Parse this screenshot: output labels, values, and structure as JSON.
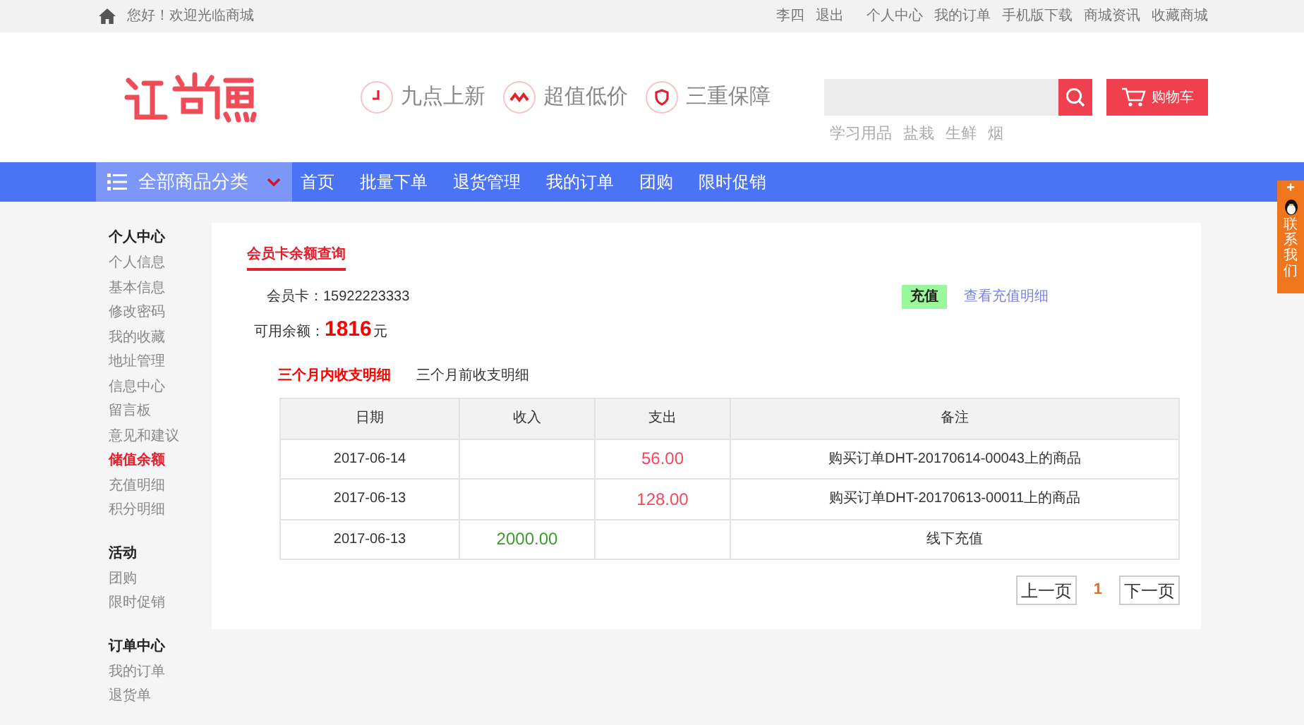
{
  "top_bar": {
    "greeting": "您好！欢迎光临商城",
    "links": [
      "李四",
      "退出",
      "个人中心",
      "我的订单",
      "手机版下载",
      "商城资讯",
      "收藏商城"
    ]
  },
  "header": {
    "promises": [
      "九点上新",
      "超值低价",
      "三重保障"
    ],
    "search": {
      "hot_words": [
        "学习用品",
        "盐栽",
        "生鲜",
        "烟"
      ]
    },
    "cart_button": "购物车"
  },
  "nav": {
    "category": "全部商品分类",
    "items": [
      "首页",
      "批量下单",
      "退货管理",
      "我的订单",
      "团购",
      "限时促销"
    ]
  },
  "sidebar": [
    {
      "title": "个人中心",
      "items": [
        {
          "label": "个人信息",
          "selected": false
        },
        {
          "label": "基本信息",
          "selected": false
        },
        {
          "label": "修改密码",
          "selected": false
        },
        {
          "label": "我的收藏",
          "selected": false
        },
        {
          "label": "地址管理",
          "selected": false
        },
        {
          "label": "信息中心",
          "selected": false
        },
        {
          "label": "留言板",
          "selected": false
        },
        {
          "label": "意见和建议",
          "selected": false
        },
        {
          "label": "储值余额",
          "selected": true
        },
        {
          "label": "充值明细",
          "selected": false
        },
        {
          "label": "积分明细",
          "selected": false
        }
      ]
    },
    {
      "title": "活动",
      "items": [
        {
          "label": "团购",
          "selected": false
        },
        {
          "label": "限时促销",
          "selected": false
        }
      ]
    },
    {
      "title": "订单中心",
      "items": [
        {
          "label": "我的订单",
          "selected": false
        },
        {
          "label": "退货单",
          "selected": false
        }
      ]
    }
  ],
  "content": {
    "title": "会员卡余额查询",
    "card_label": "会员卡：",
    "card_number": "15922223333",
    "recharge_button": "充值",
    "recharge_detail_link": "查看充值明细",
    "balance_label": "可用余额：",
    "balance": "1816",
    "balance_unit": "元",
    "tabs": [
      {
        "label": "三个月内收支明细",
        "selected": true
      },
      {
        "label": "三个月前收支明细",
        "selected": false
      }
    ],
    "table": {
      "columns": [
        "日期",
        "收入",
        "支出",
        "备注"
      ],
      "rows": [
        {
          "date": "2017-06-14",
          "income": "",
          "expense": "56.00",
          "note": "购买订单DHT-20170614-00043上的商品"
        },
        {
          "date": "2017-06-13",
          "income": "",
          "expense": "128.00",
          "note": "购买订单DHT-20170613-00011上的商品"
        },
        {
          "date": "2017-06-13",
          "income": "2000.00",
          "expense": "",
          "note": "线下充值"
        }
      ]
    },
    "pagination": {
      "prev": "上一页",
      "current": "1",
      "next": "下一页"
    }
  },
  "side_tab": {
    "plus": "+",
    "label": "联系我们"
  }
}
